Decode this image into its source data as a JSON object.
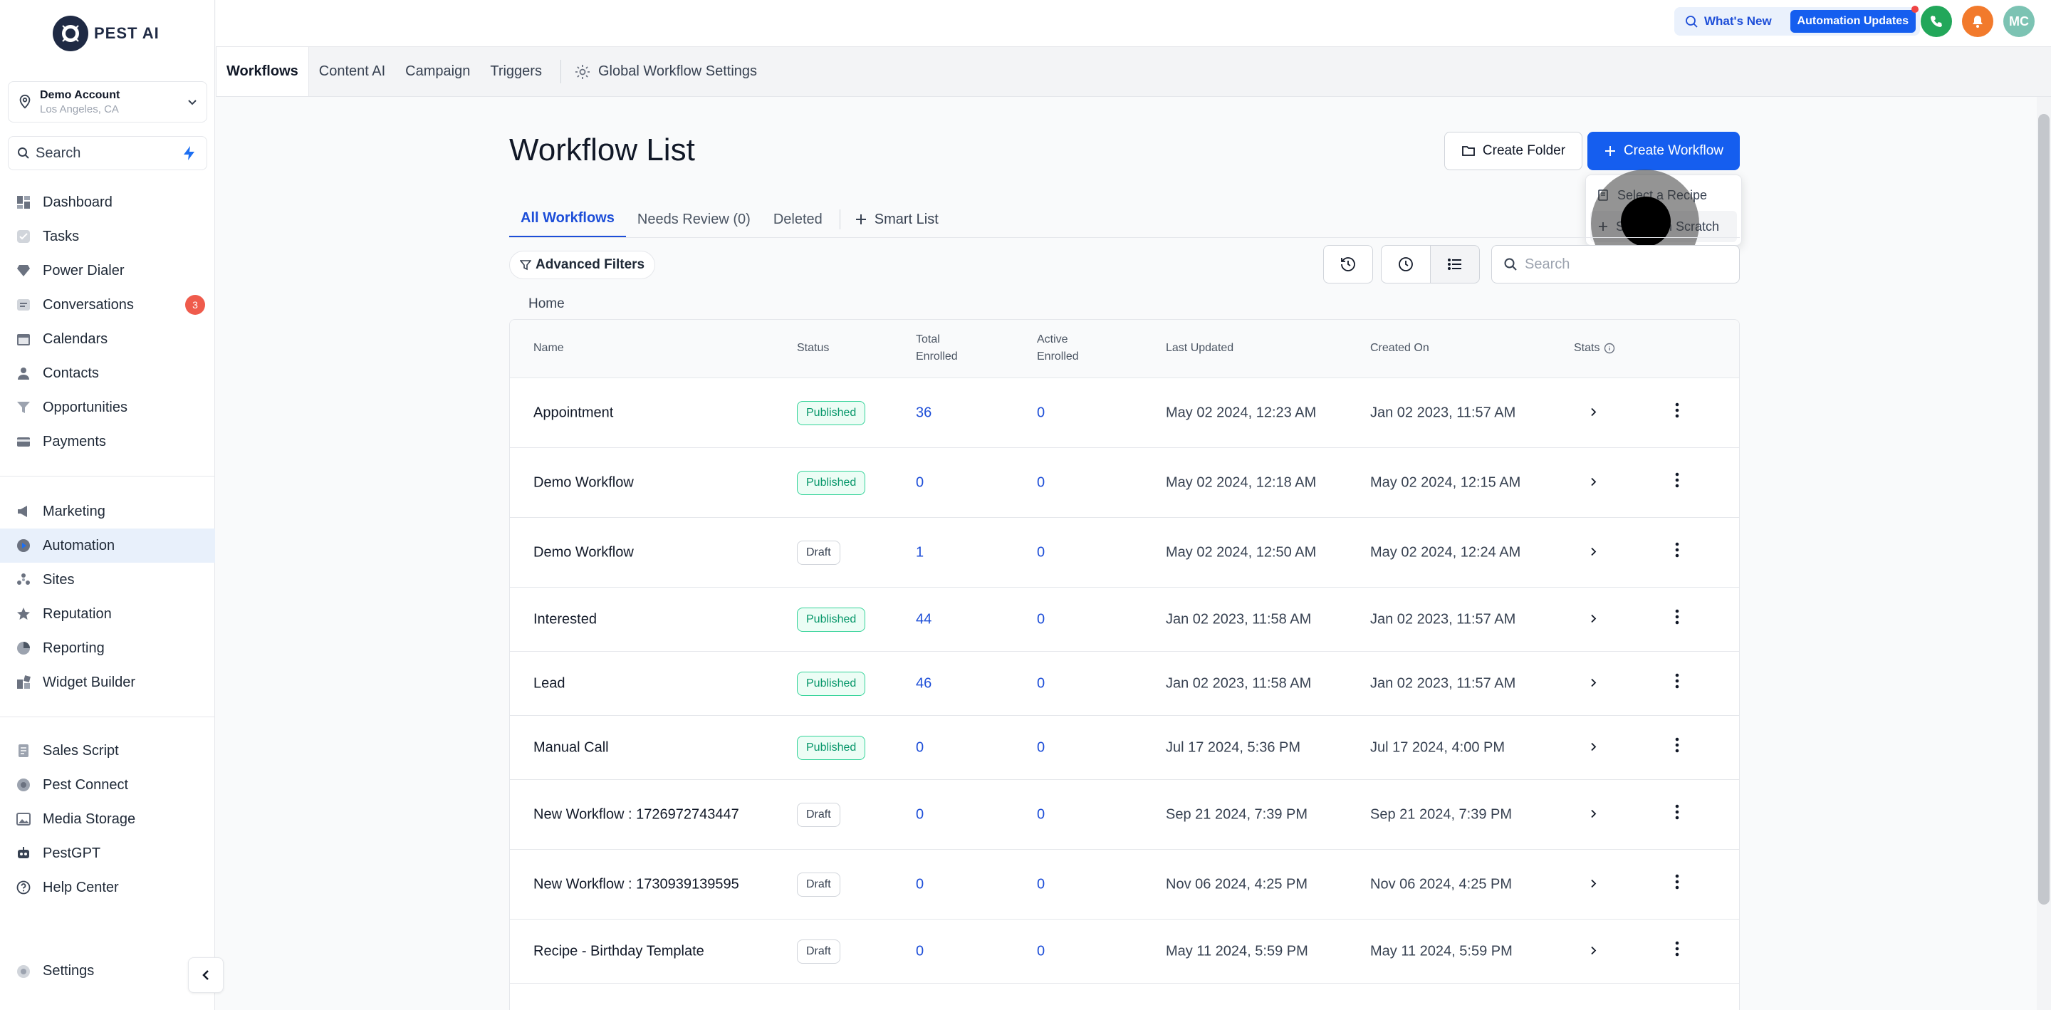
{
  "brand": {
    "name": "PEST AI"
  },
  "account": {
    "name": "Demo Account",
    "location": "Los Angeles, CA"
  },
  "sidebar": {
    "search_placeholder": "Search",
    "group1": [
      {
        "label": "Dashboard",
        "icon": "dashboard-icon"
      },
      {
        "label": "Tasks",
        "icon": "check-icon"
      },
      {
        "label": "Power Dialer",
        "icon": "gem-icon"
      },
      {
        "label": "Conversations",
        "icon": "chat-icon",
        "badge": "3"
      },
      {
        "label": "Calendars",
        "icon": "calendar-icon"
      },
      {
        "label": "Contacts",
        "icon": "person-icon"
      },
      {
        "label": "Opportunities",
        "icon": "funnel-icon"
      },
      {
        "label": "Payments",
        "icon": "card-icon"
      }
    ],
    "group2": [
      {
        "label": "Marketing",
        "icon": "megaphone-icon"
      },
      {
        "label": "Automation",
        "icon": "automation-icon",
        "active": true
      },
      {
        "label": "Sites",
        "icon": "sites-icon"
      },
      {
        "label": "Reputation",
        "icon": "star-icon"
      },
      {
        "label": "Reporting",
        "icon": "chart-icon"
      },
      {
        "label": "Widget Builder",
        "icon": "widget-icon"
      }
    ],
    "group3": [
      {
        "label": "Sales Script",
        "icon": "script-icon"
      },
      {
        "label": "Pest Connect",
        "icon": "connect-icon"
      },
      {
        "label": "Media Storage",
        "icon": "image-icon"
      },
      {
        "label": "PestGPT",
        "icon": "robot-icon"
      },
      {
        "label": "Help Center",
        "icon": "help-icon"
      }
    ],
    "settings_label": "Settings"
  },
  "topbar": {
    "whats_new": "What's New",
    "automation_updates": "Automation Updates",
    "avatar_initials": "MC"
  },
  "subnav": {
    "tabs": [
      "Workflows",
      "Content AI",
      "Campaign",
      "Triggers"
    ],
    "global_settings": "Global Workflow Settings"
  },
  "main": {
    "title": "Workflow List",
    "create_folder": "Create Folder",
    "create_workflow": "Create Workflow",
    "dropdown": [
      "Select a Recipe",
      "Start from Scratch"
    ],
    "tabs": [
      "All Workflows",
      "Needs Review (0)",
      "Deleted"
    ],
    "smart_list": "Smart List",
    "advanced_filters": "Advanced Filters",
    "search_placeholder": "Search",
    "breadcrumb": "Home"
  },
  "table": {
    "headers": {
      "name": "Name",
      "status": "Status",
      "total": "Total Enrolled",
      "active": "Active Enrolled",
      "updated": "Last Updated",
      "created": "Created On",
      "stats": "Stats"
    },
    "rows": [
      {
        "name": "Appointment",
        "status": "Published",
        "total": "36",
        "active": "0",
        "updated": "May 02 2024, 12:23 AM",
        "created": "Jan 02 2023, 11:57 AM"
      },
      {
        "name": "Demo Workflow",
        "status": "Published",
        "total": "0",
        "active": "0",
        "updated": "May 02 2024, 12:18 AM",
        "created": "May 02 2024, 12:15 AM"
      },
      {
        "name": "Demo Workflow",
        "status": "Draft",
        "total": "1",
        "active": "0",
        "updated": "May 02 2024, 12:50 AM",
        "created": "May 02 2024, 12:24 AM"
      },
      {
        "name": "Interested",
        "status": "Published",
        "total": "44",
        "active": "0",
        "updated": "Jan 02 2023, 11:58 AM",
        "created": "Jan 02 2023, 11:57 AM"
      },
      {
        "name": "Lead",
        "status": "Published",
        "total": "46",
        "active": "0",
        "updated": "Jan 02 2023, 11:58 AM",
        "created": "Jan 02 2023, 11:57 AM"
      },
      {
        "name": "Manual Call",
        "status": "Published",
        "total": "0",
        "active": "0",
        "updated": "Jul 17 2024, 5:36 PM",
        "created": "Jul 17 2024, 4:00 PM"
      },
      {
        "name": "New Workflow : 1726972743447",
        "status": "Draft",
        "total": "0",
        "active": "0",
        "updated": "Sep 21 2024, 7:39 PM",
        "created": "Sep 21 2024, 7:39 PM"
      },
      {
        "name": "New Workflow : 1730939139595",
        "status": "Draft",
        "total": "0",
        "active": "0",
        "updated": "Nov 06 2024, 4:25 PM",
        "created": "Nov 06 2024, 4:25 PM"
      },
      {
        "name": "Recipe - Birthday Template",
        "status": "Draft",
        "total": "0",
        "active": "0",
        "updated": "May 11 2024, 5:59 PM",
        "created": "May 11 2024, 5:59 PM"
      }
    ]
  },
  "colors": {
    "accent": "#155eef",
    "published": "#059669",
    "badge_red": "#ef5b4c",
    "active_nav_bg": "#e8f0fb"
  }
}
